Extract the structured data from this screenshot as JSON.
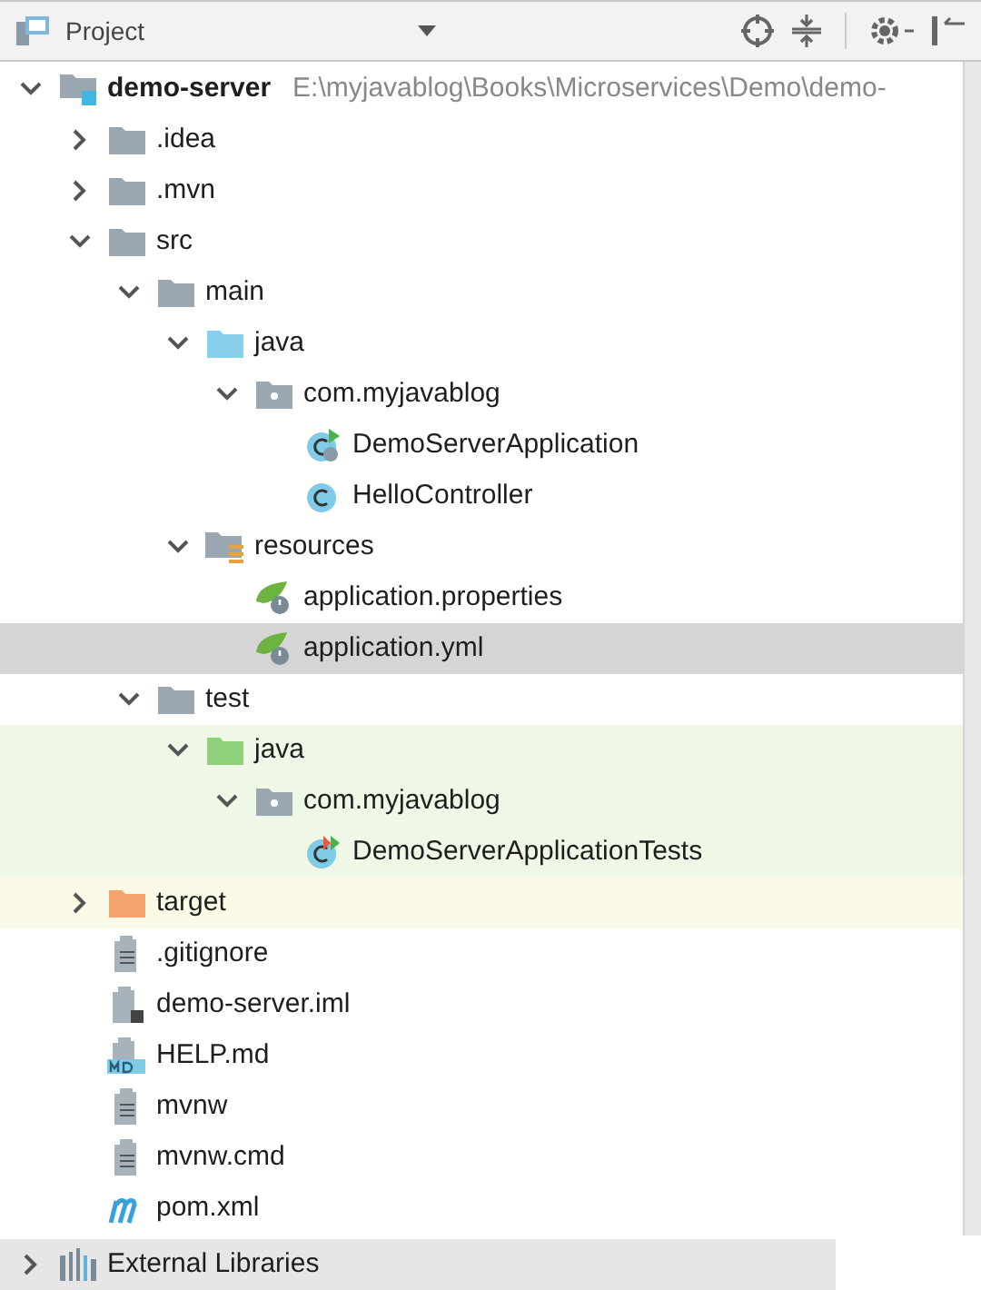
{
  "panel": {
    "title": "Project"
  },
  "tree": [
    {
      "label": "demo-server",
      "path": "E:\\myjavablog\\Books\\Microservices\\Demo\\demo-",
      "kind": "module",
      "expanded": true,
      "selected": false,
      "children": [
        {
          "label": ".idea",
          "kind": "folder",
          "expanded": false,
          "selected": false
        },
        {
          "label": ".mvn",
          "kind": "folder",
          "expanded": false,
          "selected": false
        },
        {
          "label": "src",
          "kind": "folder",
          "expanded": true,
          "selected": false,
          "children": [
            {
              "label": "main",
              "kind": "folder",
              "expanded": true,
              "selected": false,
              "children": [
                {
                  "label": "java",
                  "kind": "source",
                  "expanded": true,
                  "selected": false,
                  "children": [
                    {
                      "label": "com.myjavablog",
                      "kind": "package",
                      "expanded": true,
                      "selected": false,
                      "children": [
                        {
                          "label": "DemoServerApplication",
                          "kind": "spring-class",
                          "selected": false
                        },
                        {
                          "label": "HelloController",
                          "kind": "class",
                          "selected": false
                        }
                      ]
                    }
                  ]
                },
                {
                  "label": "resources",
                  "kind": "resources",
                  "expanded": true,
                  "selected": false,
                  "children": [
                    {
                      "label": "application.properties",
                      "kind": "spring-config",
                      "selected": false
                    },
                    {
                      "label": "application.yml",
                      "kind": "spring-config",
                      "selected": true
                    }
                  ]
                }
              ]
            },
            {
              "label": "test",
              "kind": "folder",
              "expanded": true,
              "selected": false,
              "children": [
                {
                  "label": "java",
                  "kind": "test-source",
                  "expanded": true,
                  "selected": false,
                  "color": "#eff8e6",
                  "children": [
                    {
                      "label": "com.myjavablog",
                      "kind": "package",
                      "expanded": true,
                      "selected": false,
                      "color": "#eff8e6",
                      "children": [
                        {
                          "label": "DemoServerApplicationTests",
                          "kind": "test-class",
                          "selected": false,
                          "color": "#eff8e6"
                        }
                      ]
                    }
                  ]
                }
              ]
            }
          ]
        },
        {
          "label": "target",
          "kind": "excluded",
          "expanded": false,
          "selected": false,
          "color": "#fbfae6"
        },
        {
          "label": ".gitignore",
          "kind": "text",
          "selected": false
        },
        {
          "label": "demo-server.iml",
          "kind": "iml",
          "selected": false
        },
        {
          "label": "HELP.md",
          "kind": "markdown",
          "selected": false
        },
        {
          "label": "mvnw",
          "kind": "text",
          "selected": false
        },
        {
          "label": "mvnw.cmd",
          "kind": "text",
          "selected": false
        },
        {
          "label": "pom.xml",
          "kind": "maven",
          "selected": false
        }
      ]
    },
    {
      "label": "External Libraries",
      "kind": "libraries",
      "expanded": false,
      "selected": false
    }
  ]
}
